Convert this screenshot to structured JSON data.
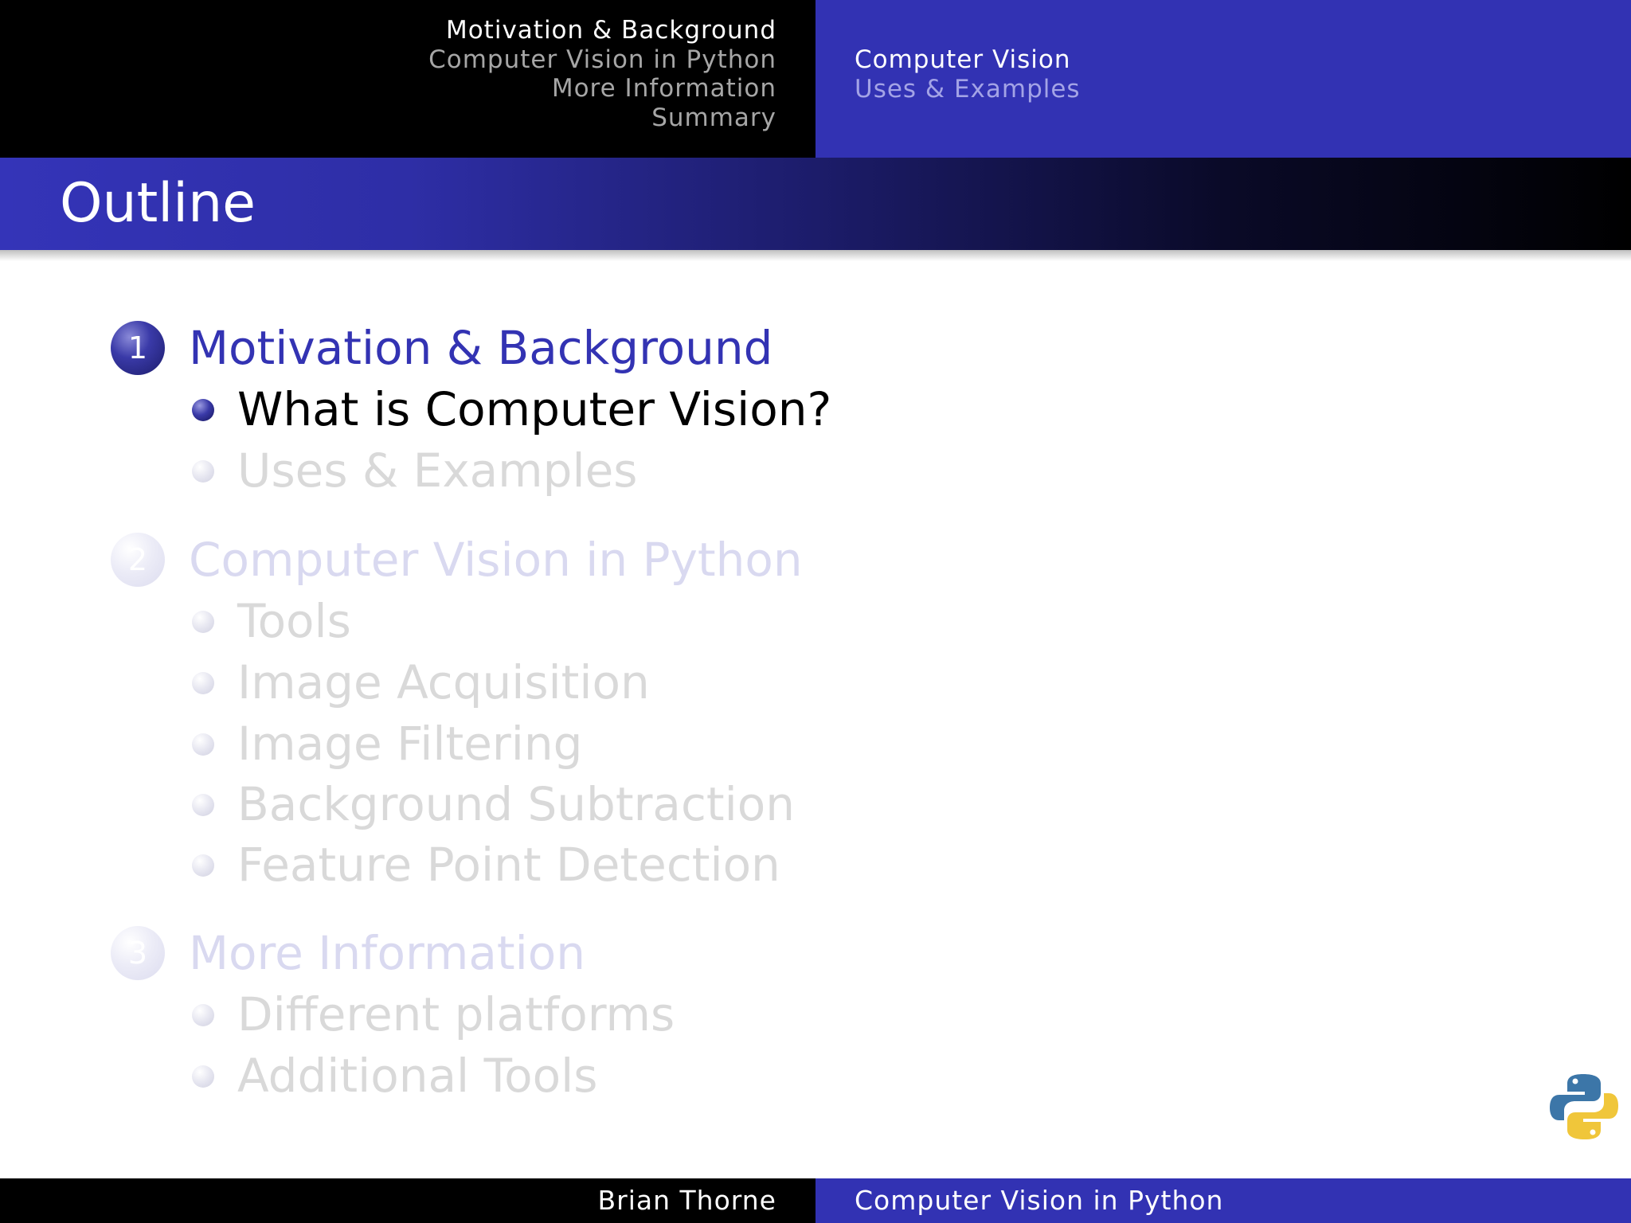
{
  "header": {
    "sections": [
      {
        "label": "Motivation & Background",
        "active": true
      },
      {
        "label": "Computer Vision in Python",
        "active": false
      },
      {
        "label": "More Information",
        "active": false
      },
      {
        "label": "Summary",
        "active": false
      }
    ],
    "subsections": [
      {
        "label": "Computer Vision",
        "active": true
      },
      {
        "label": "Uses & Examples",
        "active": false
      }
    ]
  },
  "frame": {
    "title": "Outline"
  },
  "outline": [
    {
      "number": "1",
      "label": "Motivation & Background",
      "active": true,
      "items": [
        {
          "label": "What is Computer Vision?",
          "active": true
        },
        {
          "label": "Uses & Examples",
          "active": false
        }
      ]
    },
    {
      "number": "2",
      "label": "Computer Vision in Python",
      "active": false,
      "items": [
        {
          "label": "Tools",
          "active": false
        },
        {
          "label": "Image Acquisition",
          "active": false
        },
        {
          "label": "Image Filtering",
          "active": false
        },
        {
          "label": "Background Subtraction",
          "active": false
        },
        {
          "label": "Feature Point Detection",
          "active": false
        }
      ]
    },
    {
      "number": "3",
      "label": "More Information",
      "active": false,
      "items": [
        {
          "label": "Different platforms",
          "active": false
        },
        {
          "label": "Additional Tools",
          "active": false
        }
      ]
    }
  ],
  "logo": {
    "icon": "python-logo-icon"
  },
  "footer": {
    "author": "Brian Thorne",
    "title": "Computer Vision in Python"
  },
  "colors": {
    "theme_blue": "#3232b3",
    "header_black": "#000000"
  }
}
